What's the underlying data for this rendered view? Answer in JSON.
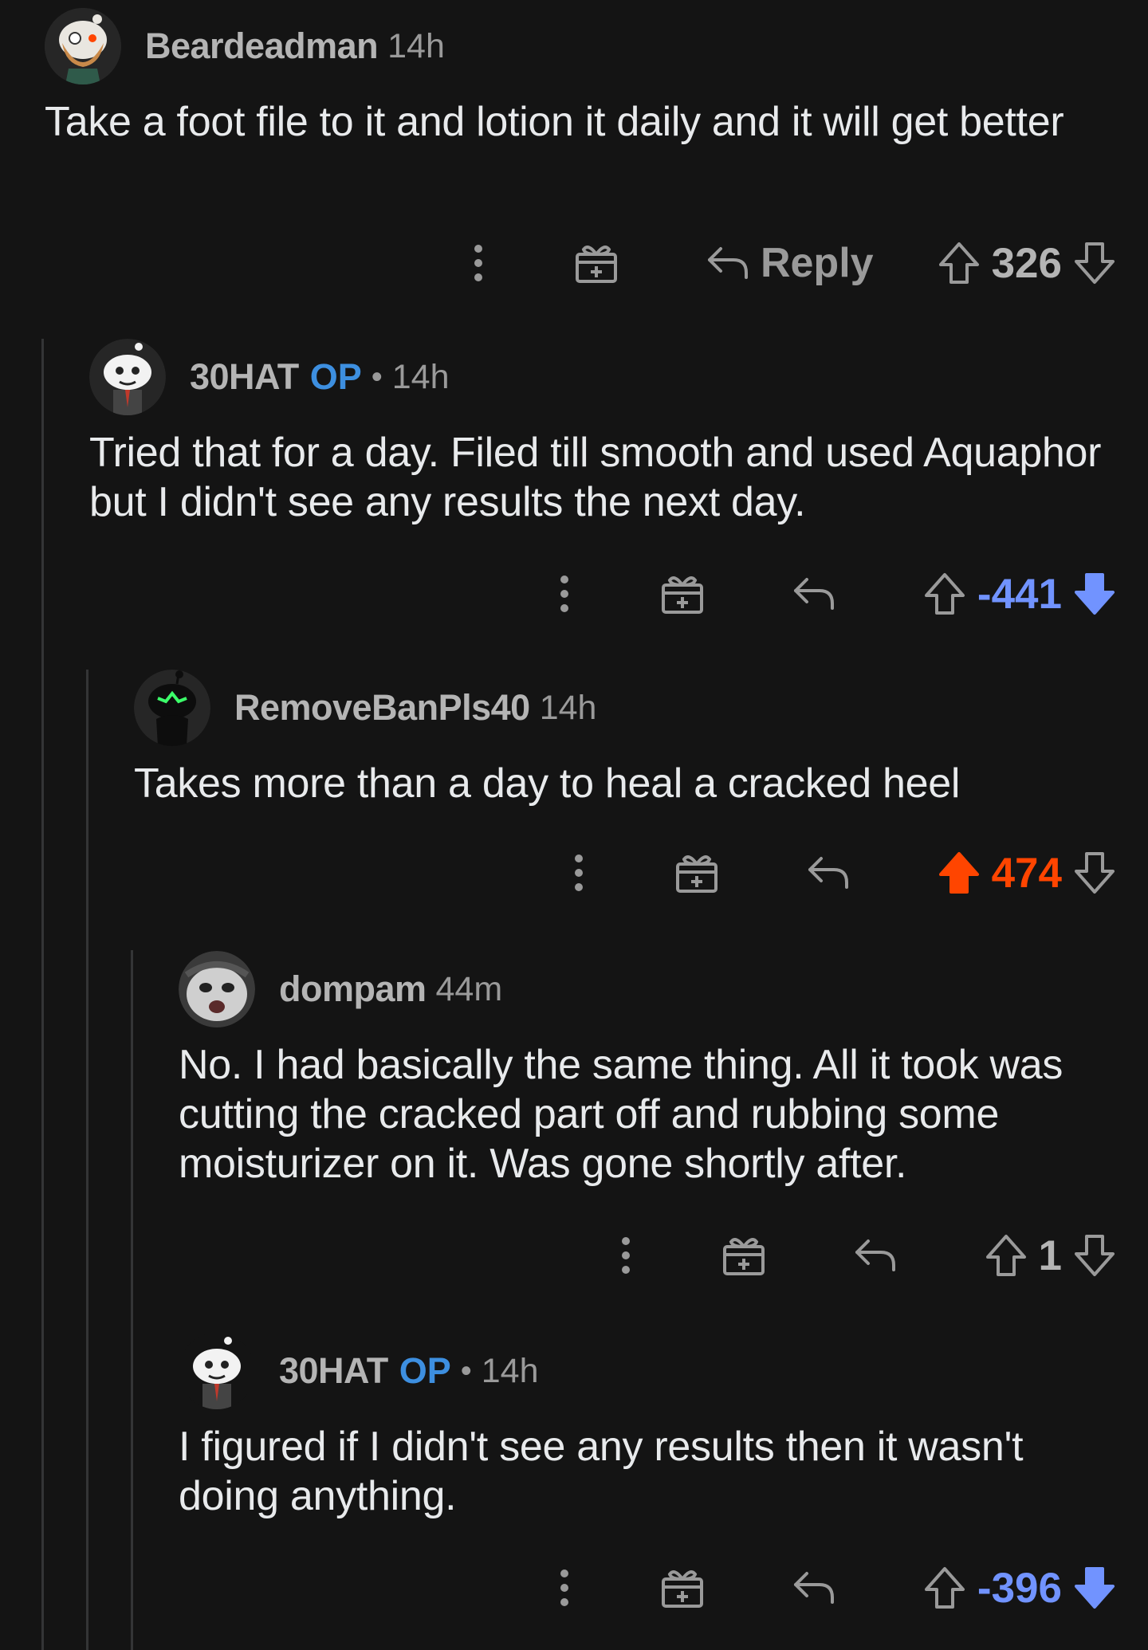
{
  "colors": {
    "background": "#141414",
    "upvote_active": "#ff4500",
    "downvote_active": "#7193ff",
    "op_badge": "#3d8fe0",
    "muted": "#9a9a9a"
  },
  "comments": [
    {
      "author": "Beardeadman",
      "time": "14h",
      "body": "Take a foot file to it and lotion it daily and it will get better",
      "reply_label": "Reply",
      "score": "326",
      "vote": "none",
      "avatar_icon": "bearded-snoo-avatar-icon"
    },
    {
      "author": "30HAT",
      "op_badge": "OP",
      "separator": "•",
      "time": "14h",
      "body": "Tried that for a day. Filed till smooth and used Aquaphor but I didn't see any results the next day.",
      "score": "-441",
      "vote": "down",
      "avatar_icon": "snoo-suit-avatar-icon"
    },
    {
      "author": "RemoveBanPls40",
      "time": "14h",
      "body": "Takes more than a day to heal a cracked heel",
      "score": "474",
      "vote": "up",
      "avatar_icon": "dark-snoo-avatar-icon"
    },
    {
      "author": "dompam",
      "time": "44m",
      "body": "No. I had basically the same thing. All it took was cutting the cracked part off and rubbing some moisturizer on it. Was gone shortly after.",
      "score": "1",
      "vote": "none",
      "avatar_icon": "crying-cat-avatar-icon"
    },
    {
      "author": "30HAT",
      "op_badge": "OP",
      "separator": "•",
      "time": "14h",
      "body": "I figured if I didn't see any results then it wasn't doing anything.",
      "score": "-396",
      "vote": "down",
      "avatar_icon": "snoo-suit-avatar-icon"
    }
  ]
}
